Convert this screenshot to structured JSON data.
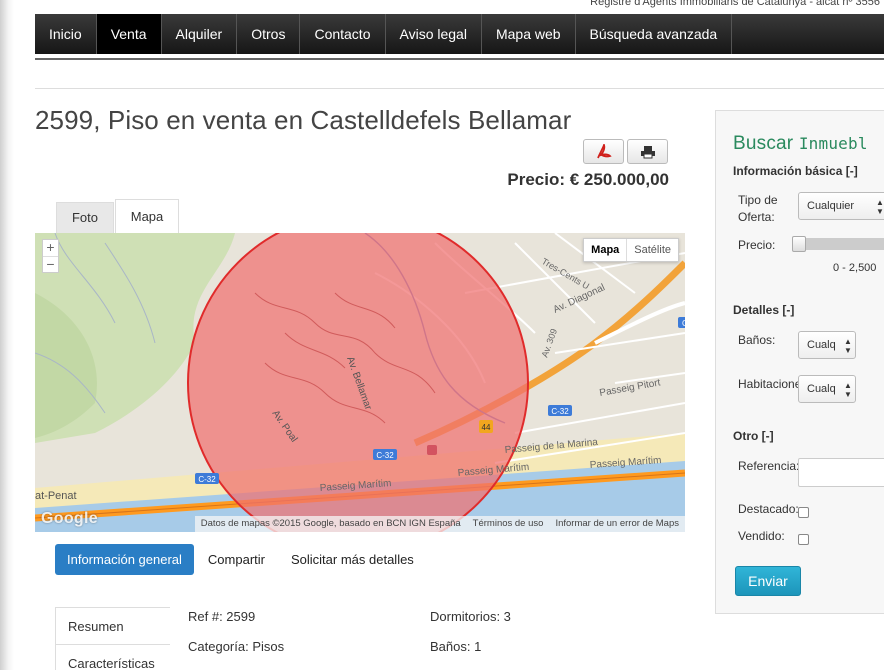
{
  "header": {
    "registry_text": "Registre d'Agents Immobiliaris de Catalunya - aicat nº 3556"
  },
  "nav": {
    "items": [
      {
        "label": "Inicio",
        "active": false
      },
      {
        "label": "Venta",
        "active": true
      },
      {
        "label": "Alquiler",
        "active": false
      },
      {
        "label": "Otros",
        "active": false
      },
      {
        "label": "Contacto",
        "active": false
      },
      {
        "label": "Aviso legal",
        "active": false
      },
      {
        "label": "Mapa web",
        "active": false
      },
      {
        "label": "Búsqueda avanzada",
        "active": false
      }
    ]
  },
  "listing": {
    "title": "2599, Piso en venta en Castelldefels Bellamar",
    "price": "Precio: € 250.000,00",
    "icons": [
      "pdf-icon",
      "print-icon"
    ]
  },
  "media_tabs": [
    "Foto",
    "Mapa"
  ],
  "map": {
    "type_active": "Mapa",
    "type_other": "Satélite",
    "zoom_in": "+",
    "zoom_out": "−",
    "logo": "Google",
    "footer": [
      "Datos de mapas ©2015 Google, basado en BCN IGN España",
      "Términos de uso",
      "Informar de un error de Maps"
    ],
    "labels": {
      "av_diagonal": "Av. Diagonal",
      "tres_cents": "Tres-Cents U",
      "av_309": "Av. 309",
      "av_bellamar": "Av. Bellamar",
      "av_poal": "Av. Poal",
      "passeig_pitort": "Passeig Pitort",
      "passeig_marina": "Passeig de la Marina",
      "passeig_maritim_1": "Passeig Marítim",
      "passeig_maritim_2": "Passeig Marítim",
      "passeig_maritim_3": "Passeig Marítim",
      "at_penat": "at-Penat",
      "c32_a": "C-32",
      "c32_b": "C-32",
      "c32_c": "C-32",
      "road_44": "44",
      "edge_marker": "C"
    }
  },
  "info_tabs": [
    {
      "label": "Información general",
      "active": true
    },
    {
      "label": "Compartir",
      "active": false
    },
    {
      "label": "Solicitar más detalles",
      "active": false
    }
  ],
  "side_tabs": [
    "Resumen",
    "Características"
  ],
  "details": {
    "ref": "Ref #: 2599",
    "categoria": "Categoría: Pisos",
    "dormitorios": "Dormitorios: 3",
    "banos": "Baños: 1"
  },
  "sidebar": {
    "title_word1": "Buscar",
    "title_word2": "Inmuebl",
    "basic_heading": "Información básica [-]",
    "tipo_label": "Tipo de Oferta:",
    "tipo_value": "Cualquier",
    "precio_label": "Precio:",
    "precio_range": "0 - 2,500",
    "details_heading": "Detalles [-]",
    "banos_label": "Baños:",
    "banos_value": "Cualq",
    "habitaciones_label": "Habitacione",
    "habitaciones_value": "Cualq",
    "otro_heading": "Otro [-]",
    "referencia_label": "Referencia:",
    "destacado_label": "Destacado:",
    "vendido_label": "Vendido:",
    "submit_label": "Enviar"
  },
  "colors": {
    "nav_bg": "#1e1e1e",
    "accent_blue": "#2a7ec5",
    "sidebar_title": "#2a8a5e",
    "submit_button": "#1f9dc2",
    "map_circle": "#f08080"
  }
}
